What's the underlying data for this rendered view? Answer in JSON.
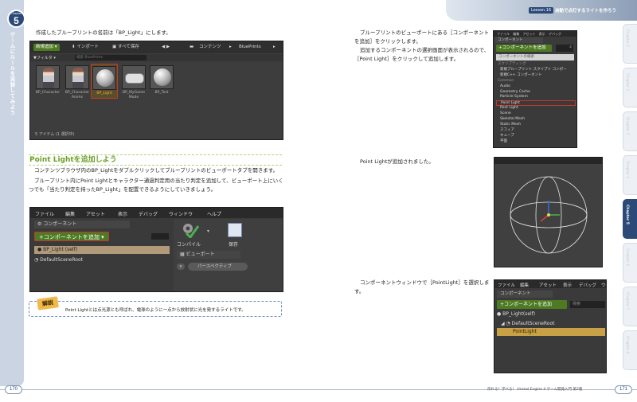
{
  "header": {
    "lesson_tag": "Lesson.16",
    "title": "自動で点灯するライトを作ろう"
  },
  "left_chapter": {
    "label": "Chapter",
    "number": "5",
    "vertical_title": "ゲームにルールを実装してみよう"
  },
  "right_tabs": [
    "Chapter 1",
    "Chapter 2",
    "Chapter 3",
    "Chapter 4",
    "Chapter 5",
    "Chapter 6",
    "Chapter 7",
    "Chapter 8"
  ],
  "left_page": {
    "intro": "作成したブループリントの名前は「BP_Light」にします。",
    "section_title": "Point Lightを追加しよう",
    "para1": "コンテンツブラウザ内のBP_Lightをダブルクリックしてブループリントのビューポートタブを開きます。",
    "para2": "ブループリント内にPoint Lightとキャラクター通過判定用の当たり判定を追加して、ビューポート上にいくつでも「当たり判定を持ったBP_Light」を配置できるようにしていきましょう。",
    "callout_tag": "解説",
    "callout_text": "Point Lightとは点光源とも呼ばれ、電球のように一点から放射状に光を発するライトです。"
  },
  "content_browser": {
    "new_button": "新規追加",
    "import": "インポート",
    "save_all": "すべて保存",
    "contents": "コンテンツ",
    "path": "BluePrints",
    "filter": "フィルタ",
    "search_placeholder": "検索 BluePrints",
    "assets": [
      "BP_Character",
      "BP_Character Anims",
      "BP_Light",
      "BP_MyGame Mode",
      "BP_Test"
    ],
    "count": "5 アイテム (1 選択中)"
  },
  "bp_editor": {
    "menu": [
      "ファイル",
      "編集",
      "アセット",
      "表示",
      "デバッグ",
      "ウィンドウ",
      "ヘルプ"
    ],
    "components_tab": "コンポーネント",
    "add_component": "+コンポーネントを追加",
    "self_row": "BP_Light (self)",
    "root_row": "DefaultSceneRoot",
    "compile": "コンパイル",
    "save": "保存",
    "viewport_tab": "ビューポート",
    "perspective": "パースペクティブ"
  },
  "right_page": {
    "para1": "ブループリントのビューポートにある［コンポーネントを追加］をクリックします。",
    "para2": "追加するコンポーネントの選択画面が表示されるので、［Point Light］をクリックして追加します。",
    "para3": "Point Lightが追加されました。",
    "para4": "コンポーネントウィンドウで［PointLight］を選択します。"
  },
  "add_menu": {
    "bar": "ファイル 編集 アセット 表示 デバッグ",
    "tab": "コンポーネント",
    "add_button": "+コンポーネントを追加",
    "search": "コンポーネントの検索",
    "items": [
      {
        "label": "スクリプティング",
        "type": "sub"
      },
      {
        "label": "新規ブループリント スクリプト コンポー",
        "type": "item"
      },
      {
        "label": "新規C++ コンポーネント",
        "type": "item"
      },
      {
        "label": "Common",
        "type": "sub"
      },
      {
        "label": "Audio",
        "type": "item"
      },
      {
        "label": "Geometry Cache",
        "type": "item"
      },
      {
        "label": "Particle System",
        "type": "item"
      },
      {
        "label": "Point Light",
        "type": "hl"
      },
      {
        "label": "Rect Light",
        "type": "item"
      },
      {
        "label": "Scene",
        "type": "item"
      },
      {
        "label": "Skeletal Mesh",
        "type": "item"
      },
      {
        "label": "Static Mesh",
        "type": "item"
      },
      {
        "label": "スフィア",
        "type": "item"
      },
      {
        "label": "キューブ",
        "type": "item"
      },
      {
        "label": "平面",
        "type": "item"
      }
    ]
  },
  "hierarchy": {
    "menu": [
      "ファイル",
      "編集",
      "アセット",
      "表示",
      "デバッグ",
      "ウ"
    ],
    "tab": "コンポーネント",
    "add_button": "+コンポーネントを追加",
    "search": "検索",
    "self_row": "BP_Light(self)",
    "root_row": "DefaultSceneRoot",
    "pointlight_row": "PointLight"
  },
  "footer": {
    "page_left": "170",
    "page_right": "171",
    "text": "作れる！学べる！ Unreal Engine 4 ゲーム開発入門 第2版"
  },
  "colors": {
    "accent_navy": "#2c4a78",
    "section_green": "#6a9f27",
    "highlight_red": "#c0392b",
    "ue_button_green": "#4d7a22"
  }
}
